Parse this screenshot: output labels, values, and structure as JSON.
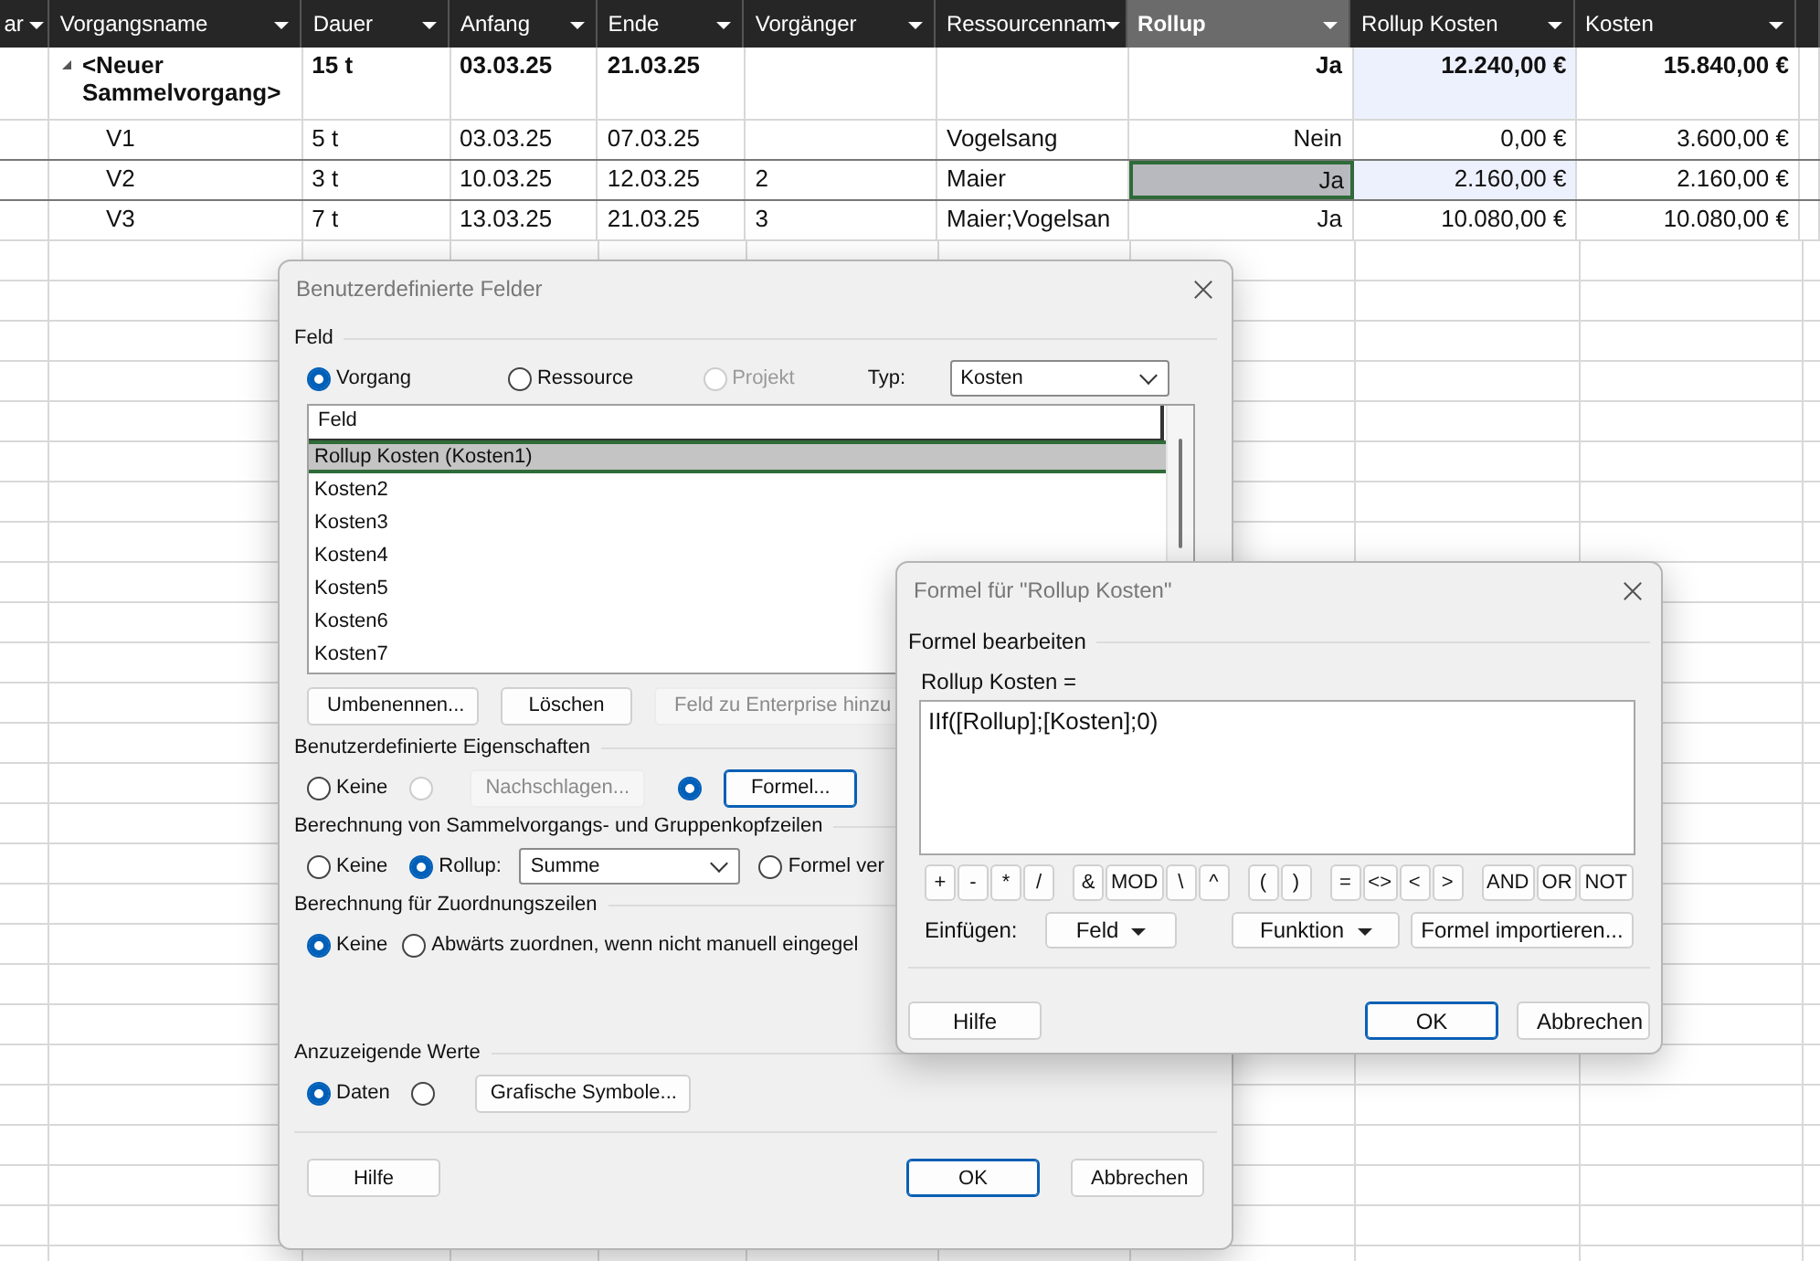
{
  "sheet": {
    "columns": [
      {
        "label": "ar",
        "dropdown": true,
        "selected": false
      },
      {
        "label": "Vorgangsname",
        "dropdown": true,
        "selected": false
      },
      {
        "label": "Dauer",
        "dropdown": true,
        "selected": false
      },
      {
        "label": "Anfang",
        "dropdown": true,
        "selected": false
      },
      {
        "label": "Ende",
        "dropdown": true,
        "selected": false
      },
      {
        "label": "Vorgänger",
        "dropdown": true,
        "selected": false
      },
      {
        "label": "Ressourcennam",
        "dropdown": true,
        "selected": false
      },
      {
        "label": "Rollup",
        "dropdown": true,
        "selected": true
      },
      {
        "label": "Rollup Kosten",
        "dropdown": true,
        "selected": false
      },
      {
        "label": "Kosten",
        "dropdown": true,
        "selected": false
      }
    ],
    "rows": [
      {
        "kind": "summary",
        "expanded": true,
        "selected": false,
        "rollup_selected": false,
        "rollup_cost_highlighted": true,
        "name": "<Neuer Sammelvorgang>",
        "duration": "15 t",
        "start": "03.03.25",
        "finish": "21.03.25",
        "rollup": "Ja",
        "rollup_cost": "12.240,00 €",
        "cost": "15.840,00 €"
      },
      {
        "kind": "task",
        "selected": false,
        "rollup_selected": false,
        "rollup_cost_highlighted": false,
        "name": "V1",
        "duration": "5 t",
        "start": "03.03.25",
        "finish": "07.03.25",
        "resources": "Vogelsang",
        "rollup": "Nein",
        "rollup_cost": "0,00 €",
        "cost": "3.600,00 €"
      },
      {
        "kind": "task",
        "selected": true,
        "rollup_selected": true,
        "rollup_cost_highlighted": true,
        "name": "V2",
        "duration": "3 t",
        "start": "10.03.25",
        "finish": "12.03.25",
        "predecessors": "2",
        "resources": "Maier",
        "rollup": "Ja",
        "rollup_cost": "2.160,00 €",
        "cost": "2.160,00 €"
      },
      {
        "kind": "task",
        "selected": false,
        "rollup_selected": false,
        "rollup_cost_highlighted": false,
        "name": "V3",
        "duration": "7 t",
        "start": "13.03.25",
        "finish": "21.03.25",
        "predecessors": "3",
        "resources": "Maier;Vogelsan",
        "rollup": "Ja",
        "rollup_cost": "10.080,00 €",
        "cost": "10.080,00 €"
      }
    ]
  },
  "custom_fields_dialog": {
    "title": "Benutzerdefinierte Felder",
    "field_section": {
      "label": "Feld",
      "scope": [
        {
          "label": "Vorgang",
          "selected": true,
          "disabled": false
        },
        {
          "label": "Ressource",
          "selected": false,
          "disabled": false
        },
        {
          "label": "Projekt",
          "selected": false,
          "disabled": true
        }
      ],
      "type_label": "Typ:",
      "type_value": "Kosten",
      "list_header": "Feld",
      "items": [
        {
          "label": "Rollup Kosten (Kosten1)",
          "selected": true
        },
        {
          "label": "Kosten2",
          "selected": false
        },
        {
          "label": "Kosten3",
          "selected": false
        },
        {
          "label": "Kosten4",
          "selected": false
        },
        {
          "label": "Kosten5",
          "selected": false
        },
        {
          "label": "Kosten6",
          "selected": false
        },
        {
          "label": "Kosten7",
          "selected": false
        }
      ],
      "buttons": [
        {
          "label": "Umbenennen...",
          "disabled": false
        },
        {
          "label": "Löschen",
          "disabled": false
        },
        {
          "label": "Feld zu Enterprise hinzu",
          "disabled": true
        }
      ]
    },
    "sections": [
      {
        "label": "Benutzerdefinierte Eigenschaften",
        "options": [
          {
            "kind": "radio",
            "label": "Keine",
            "selected": false,
            "disabled": false
          },
          {
            "kind": "radio",
            "selected": false,
            "disabled": true
          },
          {
            "kind": "button",
            "label": "Nachschlagen...",
            "disabled": true,
            "default": false
          },
          {
            "kind": "radio",
            "selected": true,
            "disabled": false
          },
          {
            "kind": "button",
            "label": "Formel...",
            "disabled": false,
            "default": true
          }
        ]
      },
      {
        "label": "Berechnung von Sammelvorgangs- und Gruppenkopfzeilen",
        "options": [
          {
            "kind": "radio",
            "label": "Keine",
            "selected": false,
            "disabled": false
          },
          {
            "kind": "radio",
            "label": "Rollup:",
            "selected": true,
            "disabled": false
          },
          {
            "kind": "select",
            "value": "Summe"
          },
          {
            "kind": "radio",
            "label": "Formel ver",
            "selected": false,
            "disabled": false
          }
        ]
      },
      {
        "label": "Berechnung für Zuordnungszeilen",
        "options": [
          {
            "kind": "radio",
            "label": "Keine",
            "selected": true,
            "disabled": false
          },
          {
            "kind": "radio",
            "label": "Abwärts zuordnen, wenn nicht manuell eingegel",
            "selected": false,
            "disabled": false
          }
        ]
      },
      {
        "label": "Anzuzeigende Werte",
        "options": [
          {
            "kind": "radio",
            "label": "Daten",
            "selected": true,
            "disabled": false
          },
          {
            "kind": "radio",
            "selected": false,
            "disabled": false
          },
          {
            "kind": "button",
            "label": "Grafische Symbole...",
            "disabled": false,
            "default": false
          }
        ]
      }
    ],
    "footer": [
      {
        "label": "Hilfe",
        "default": false
      },
      {
        "label": "OK",
        "default": true
      },
      {
        "label": "Abbrechen",
        "default": false
      }
    ]
  },
  "formula_dialog": {
    "title": "Formel für \"Rollup Kosten\"",
    "section": "Formel bearbeiten",
    "field_label": "Rollup Kosten =",
    "formula": "IIf([Rollup];[Kosten];0)",
    "operators": [
      [
        "+",
        "-",
        "*",
        "/"
      ],
      [
        "&",
        "MOD",
        "\\",
        "^"
      ],
      [
        "(",
        ")"
      ],
      [
        "=",
        "<>",
        "<",
        ">"
      ],
      [
        "AND",
        "OR",
        "NOT"
      ]
    ],
    "insert_label": "Einfügen:",
    "insert_buttons": [
      {
        "label": "Feld",
        "menu": true
      },
      {
        "label": "Funktion",
        "menu": true
      },
      {
        "label": "Formel importieren...",
        "menu": false
      }
    ],
    "footer": [
      {
        "label": "Hilfe",
        "default": false
      },
      {
        "label": "OK",
        "default": true
      },
      {
        "label": "Abbrechen",
        "default": false
      }
    ]
  }
}
